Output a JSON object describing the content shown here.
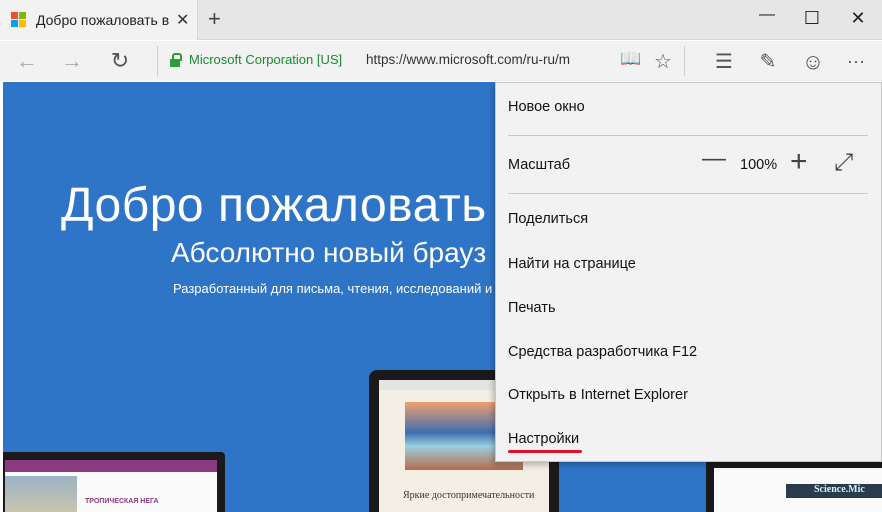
{
  "tab": {
    "title": "Добро пожаловать в Mic",
    "close": "✕",
    "new_tab": "+"
  },
  "window": {
    "minimize": "—",
    "maximize": "☐",
    "close": "✕"
  },
  "navbar": {
    "back": "←",
    "forward": "→",
    "refresh": "↻",
    "cert": "Microsoft Corporation [US]",
    "url": "https://www.microsoft.com/ru-ru/m",
    "reading_view": "📖",
    "favorite": "☆",
    "hub": "☰",
    "web_note": "✎",
    "feedback": "☺",
    "more": "···"
  },
  "page": {
    "title": "Добро пожаловать",
    "subtitle": "Абсолютно новый брауз",
    "description": "Разработанный для письма, чтения, исследований и",
    "tablet_article": "Яркие достопримечательности",
    "laptop_heading": "ТРОПИЧЕСКАЯ НЕГА",
    "phone_brand": "Science.Mic"
  },
  "menu": {
    "new_window": "Новое окно",
    "zoom_label": "Масштаб",
    "zoom_minus": "—",
    "zoom_value": "100%",
    "zoom_plus": "+",
    "fullscreen": "⤢",
    "share": "Поделиться",
    "find": "Найти на странице",
    "print": "Печать",
    "devtools": "Средства разработчика F12",
    "open_ie": "Открыть в Internet Explorer",
    "settings": "Настройки"
  },
  "colors": {
    "page_bg": "#2e74c7",
    "cert_green": "#1a8a2e",
    "settings_underline": "#e0102a"
  }
}
